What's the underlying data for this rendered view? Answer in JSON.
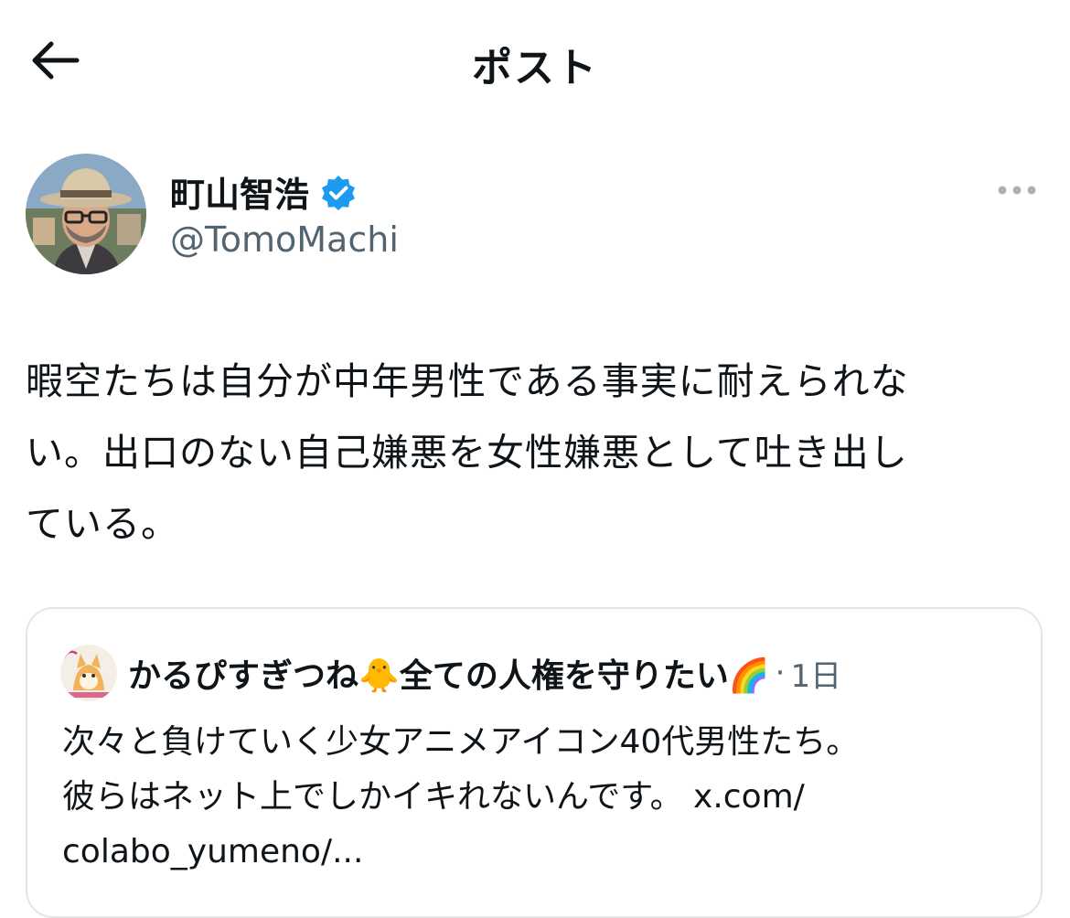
{
  "header": {
    "title": "ポスト",
    "back_icon": "arrow-left-icon"
  },
  "author": {
    "name": "町山智浩",
    "handle": "@TomoMachi",
    "verified_icon": "verified-badge-icon",
    "more_icon": "more-horizontal-icon",
    "verified_color": "#1d9bf0"
  },
  "post": {
    "text": "暇空たちは自分が中年男性である事実に耐えられな\nい。出口のない自己嫌悪を女性嫌悪として吐き出し\nている。"
  },
  "quote": {
    "name": "かるぴすぎつね🐥全ての人権を守りたい🌈",
    "separator": "·",
    "time": "1日",
    "text": "次々と負けていく少女アニメアイコン40代男性たち。\n彼らはネット上でしかイキれないんです。 x.com/\ncolabo_yumeno/..."
  },
  "colors": {
    "text": "#0f1419",
    "secondary": "#536471",
    "border": "#e3e6e8"
  }
}
